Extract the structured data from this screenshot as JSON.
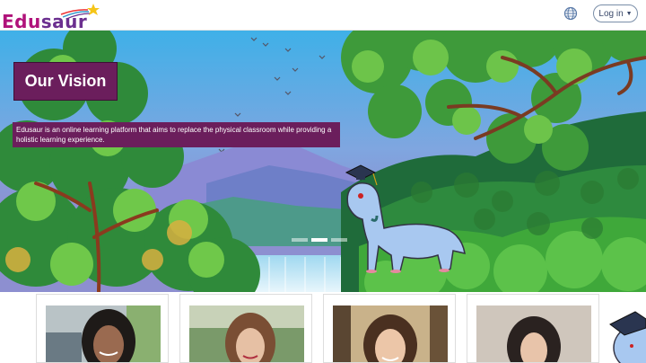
{
  "header": {
    "logo": {
      "part1": "Edu",
      "part2": "saur"
    },
    "globe_icon": "globe-icon",
    "login_label": "Log in"
  },
  "hero": {
    "title": "Our Vision",
    "caption": "Edusaur is an online learning platform that aims to replace the physical classroom while providing a holistic learning experience.",
    "carousel_active_index": 1,
    "carousel_count": 3
  },
  "team": {
    "members": [
      {
        "photo": "person-photo"
      },
      {
        "photo": "person-photo"
      },
      {
        "photo": "person-photo"
      },
      {
        "photo": "person-photo"
      }
    ]
  },
  "colors": {
    "brand_purple": "#6b1e5c",
    "logo_pink": "#b0127a",
    "logo_purple": "#6b2f8f"
  }
}
